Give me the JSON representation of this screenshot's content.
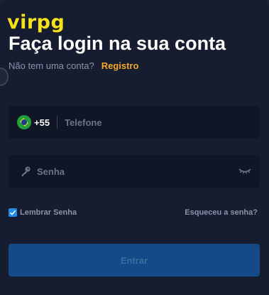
{
  "brand": {
    "logo_text": "virpg"
  },
  "header": {
    "title": "Faça login na sua conta",
    "subtitle": "Não tem uma conta?",
    "register_label": "Registro"
  },
  "phone": {
    "country_flag": "brazil-flag-icon",
    "dial_code": "+55",
    "placeholder": "Telefone"
  },
  "password": {
    "placeholder": "Senha"
  },
  "options": {
    "remember_label": "Lembrar Senha",
    "remember_checked": true,
    "forgot_label": "Esqueceu a senha?"
  },
  "submit": {
    "label": "Entrar"
  },
  "colors": {
    "background": "#171d30",
    "field": "#111626",
    "accent_link": "#f5a623",
    "logo": "#f6e21a",
    "button": "#134a87",
    "checkbox": "#1f8ae8"
  }
}
